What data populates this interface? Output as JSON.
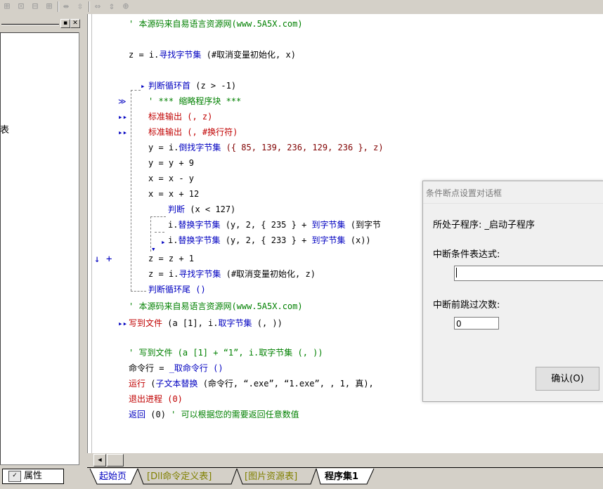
{
  "left_panel": {
    "partial_text": "表",
    "properties_tab": "属性"
  },
  "code_lines": {
    "l1": "' 本源码来自易语言资源网(www.5A5X.com)",
    "l2_a": "z = i.",
    "l2_b": "寻找字节集",
    "l2_c": " (#取消变量初始化, x)",
    "l3_a": "判断循环首",
    "l3_b": " (z > -1)",
    "l4": "' *** 缩略程序块 ***",
    "l5": "标准输出 (, z)",
    "l6": "标准输出 (, #换行符)",
    "l7_a": "y = i.",
    "l7_b": "倒找字节集",
    "l7_c": " ({ 85, 139, 236, 129, 236 }, z)",
    "l8": "y = y + 9",
    "l9": "x = x - y",
    "l10": "x = x + 12",
    "l11_a": "判断",
    "l11_b": " (x < 127)",
    "l12_a": "i.",
    "l12_b": "替换字节集",
    "l12_c": " (y, 2, { 235 } + ",
    "l12_d": "到字节集",
    "l12_e": " (到字节",
    "l13_a": "i.",
    "l13_b": "替换字节集",
    "l13_c": " (y, 2, { 233 } + ",
    "l13_d": "到字节集",
    "l13_e": " (x))",
    "l14": "z = z + 1",
    "l15_a": "z = i.",
    "l15_b": "寻找字节集",
    "l15_c": " (#取消变量初始化, z)",
    "l16": "判断循环尾 ()",
    "l17": "' 本源码来自易语言资源网(www.5A5X.com)",
    "l18_a": "写到文件",
    "l18_b": " (a [1], i.",
    "l18_c": "取字节集",
    "l18_d": " (, ))",
    "l19": "' 写到文件 (a [1] + “1”, i.取字节集 (, ))",
    "l20_a": "命令行 = ",
    "l20_b": "_取命令行 ()",
    "l21_a": "运行",
    "l21_b": " (",
    "l21_c": "子文本替换",
    "l21_d": " (命令行, “.exe”, “1.exe”, , 1, 真),",
    "l22": "退出进程 (0)",
    "l23_a": "返回",
    "l23_b": " (0) ",
    "l23_c": "' 可以根据您的需要返回任意数值"
  },
  "tabs": {
    "t1": "起始页",
    "t2": "[Dll命令定义表]",
    "t3": "[图片资源表]",
    "t4": "程序集1"
  },
  "dialog": {
    "title": "条件断点设置对话框",
    "location": "所处子程序: _启动子程序",
    "expr_label": "中断条件表达式:",
    "expr_value": "",
    "skip_label": "中断前跳过次数:",
    "skip_value": "0",
    "ok_button": "确认(O)"
  },
  "colors": {
    "comment": "#008000",
    "keyword": "#0000c0",
    "number": "#800000",
    "command_red": "#c00000"
  }
}
